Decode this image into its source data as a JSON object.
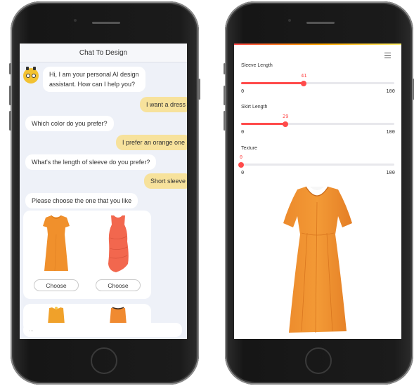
{
  "chat_app": {
    "title": "Chat To Design",
    "messages": [
      {
        "from": "bot",
        "text": "Hi, I am your personal AI design"
      },
      {
        "from": "bot",
        "text": "assistant. How can I help you?"
      },
      {
        "from": "user",
        "text": "I want a dress"
      },
      {
        "from": "bot",
        "text": "Which color do you prefer?"
      },
      {
        "from": "user",
        "text": "I prefer an orange one"
      },
      {
        "from": "bot",
        "text": "What's the length of sleeve do you prefer?"
      },
      {
        "from": "user",
        "text": "Short sleeve"
      },
      {
        "from": "bot",
        "text": "Please choose the one that you like"
      }
    ],
    "choose_label": "Choose",
    "input_placeholder": "..."
  },
  "design_app": {
    "sliders": [
      {
        "label": "Sleeve Length",
        "value": 41,
        "min": 0,
        "max": 100
      },
      {
        "label": "Skirt Length",
        "value": 29,
        "min": 0,
        "max": 100
      },
      {
        "label": "Texture",
        "value": 0,
        "min": 0,
        "max": 100
      }
    ]
  },
  "colors": {
    "accent": "#ff4b4b",
    "user_bubble": "#f7e29c",
    "chat_bg": "#eef1f8",
    "dress_orange": "#f0902c",
    "dress_coral": "#f2674e"
  },
  "icons": [
    "assistant-avatar-icon",
    "hamburger-menu-icon"
  ]
}
